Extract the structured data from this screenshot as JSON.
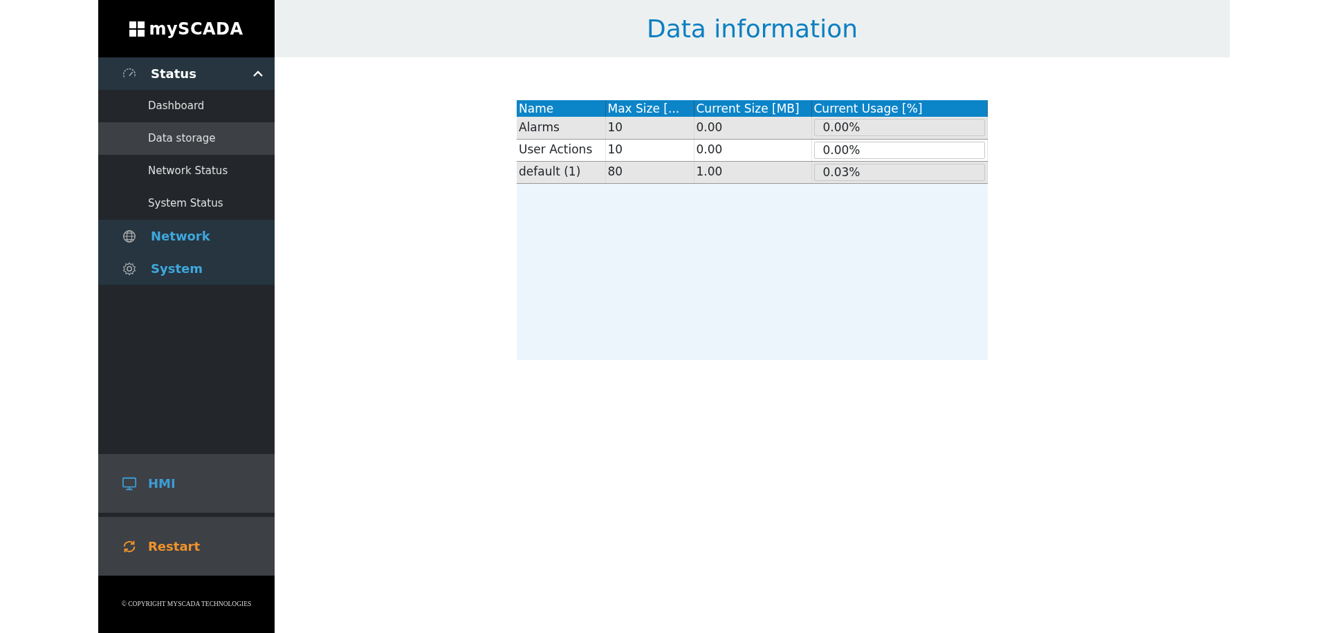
{
  "sidebar": {
    "logo": "mySCADA",
    "groups": [
      {
        "label": "Status",
        "kind": "gauge",
        "expanded": true,
        "children": [
          {
            "label": "Dashboard",
            "selected": false
          },
          {
            "label": "Data storage",
            "selected": true
          },
          {
            "label": "Network Status",
            "selected": false
          },
          {
            "label": "System Status",
            "selected": false
          }
        ]
      },
      {
        "label": "Network",
        "kind": "globe"
      },
      {
        "label": "System",
        "kind": "gear"
      }
    ],
    "actions": [
      {
        "label": "HMI",
        "kind": "monitor",
        "color": "#3d9bd4"
      },
      {
        "label": "Restart",
        "kind": "refresh",
        "color": "#f0932b"
      }
    ],
    "footer": "© COPYRIGHT MYSCADA TECHNOLOGIES"
  },
  "page": {
    "title": "Data information"
  },
  "table": {
    "columns": [
      "Name",
      "Max Size [...",
      "Current Size [MB]",
      "Current Usage [%]"
    ],
    "rows": [
      {
        "name": "Alarms",
        "max_size": "10",
        "current_size": "0.00",
        "usage": "0.00%"
      },
      {
        "name": "User Actions",
        "max_size": "10",
        "current_size": "0.00",
        "usage": "0.00%"
      },
      {
        "name": "default (1)",
        "max_size": "80",
        "current_size": "1.00",
        "usage": "0.03%"
      }
    ]
  }
}
